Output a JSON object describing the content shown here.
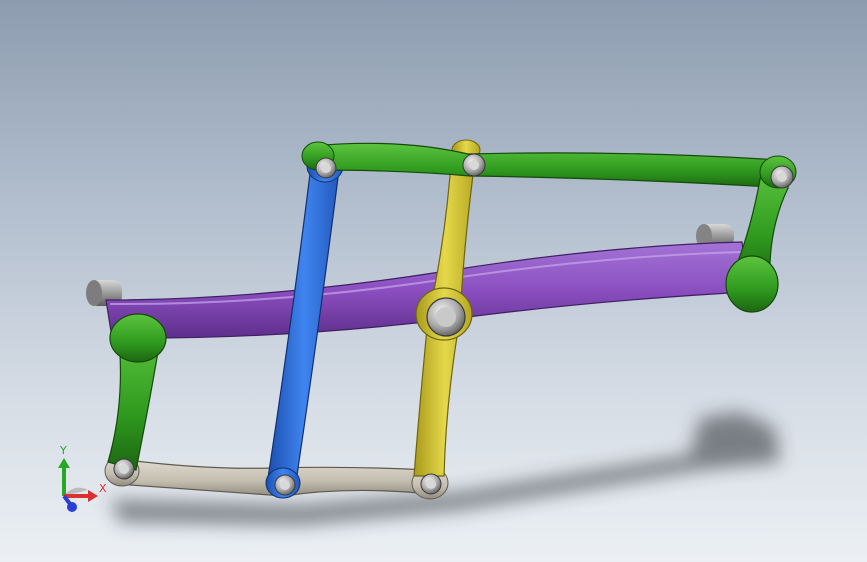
{
  "viewport": {
    "background_top": "#8d9cb0",
    "background_bottom": "#ecf0f4"
  },
  "model": {
    "parts": [
      {
        "name": "green-link-top",
        "color": "#2f9a1e"
      },
      {
        "name": "green-link-right",
        "color": "#2f9a1e"
      },
      {
        "name": "green-link-left",
        "color": "#2f9a1e"
      },
      {
        "name": "purple-beam",
        "color": "#8b4fc0"
      },
      {
        "name": "blue-link",
        "color": "#2e6fd8"
      },
      {
        "name": "yellow-link",
        "color": "#cfc12e"
      },
      {
        "name": "gray-link-bottom",
        "color": "#c7c2b4"
      }
    ]
  },
  "triad": {
    "x_label": "X",
    "y_label": "Y",
    "x_color": "#d93030",
    "y_color": "#27a827",
    "z_color": "#2b3fd6"
  }
}
